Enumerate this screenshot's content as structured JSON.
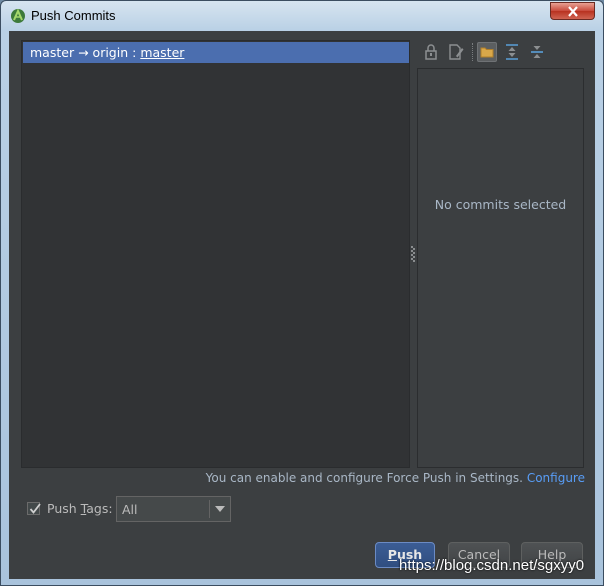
{
  "window": {
    "title": "Push Commits"
  },
  "commits_tree": {
    "branch_row": {
      "local": "master",
      "arrow": "→",
      "remote": "origin :",
      "target": "master"
    }
  },
  "details": {
    "empty_message": "No commits selected",
    "toolbar": [
      "lock-icon",
      "edit-icon",
      "folder-icon",
      "expand-all-icon",
      "collapse-all-icon"
    ]
  },
  "info": {
    "text": "You can enable and configure Force Push in Settings.",
    "link": "Configure"
  },
  "push_tags": {
    "checked": true,
    "label_before": "Push ",
    "label_mnemonic": "T",
    "label_after": "ags:",
    "value": "All"
  },
  "buttons": {
    "push_mnemonic": "P",
    "push_rest": "ush",
    "cancel": "Cancel",
    "help": "Help"
  },
  "watermark": "https://blog.csdn.net/sgxyy0",
  "colors": {
    "selection": "#4b6eaf",
    "panel": "#313335",
    "background": "#3c3f41",
    "link": "#589df6"
  }
}
